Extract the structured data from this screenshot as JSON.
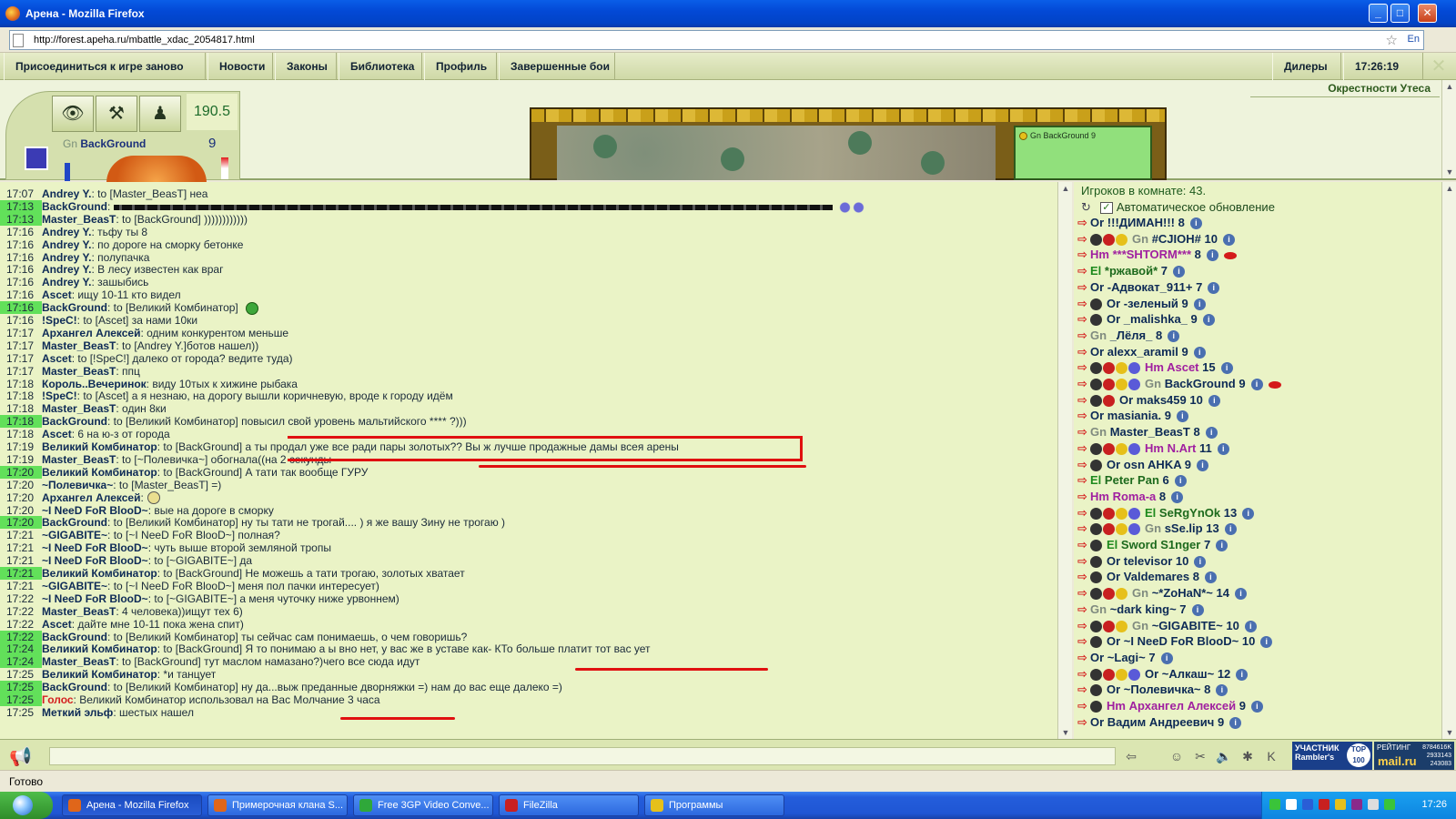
{
  "window": {
    "title": "Арена - Mozilla Firefox"
  },
  "browser": {
    "url": "http://forest.apeha.ru/mbattle_xdac_2054817.html",
    "lang": "En"
  },
  "nav": {
    "rejoin": "Присоединиться к игре заново",
    "news": "Новости",
    "laws": "Законы",
    "library": "Библиотека",
    "profile": "Профиль",
    "finished": "Завершенные бои",
    "dealers": "Дилеры",
    "time": "17:26:19"
  },
  "location": "Окрестности Утеса",
  "character": {
    "race": "Gn",
    "name": "BackGround",
    "level": "9",
    "score": "190.5"
  },
  "map": {
    "info": "Gn BackGround 9"
  },
  "chat": [
    {
      "time": "17:07",
      "hl": false,
      "who": "Andrey Y.",
      "text": ": to [Master_BeasT] неа"
    },
    {
      "time": "17:13",
      "hl": true,
      "who": "BackGround",
      "text": ":",
      "extra": "scribble"
    },
    {
      "time": "17:13",
      "hl": true,
      "who": "Master_BeasT",
      "text": ": to [BackGround] ))))))))))))"
    },
    {
      "time": "17:16",
      "hl": false,
      "who": "Andrey Y.",
      "text": ": тьфу ты 8"
    },
    {
      "time": "17:16",
      "hl": false,
      "who": "Andrey Y.",
      "text": ": по дороге на сморку бетонке"
    },
    {
      "time": "17:16",
      "hl": false,
      "who": "Andrey Y.",
      "text": ": полупачка"
    },
    {
      "time": "17:16",
      "hl": false,
      "who": "Andrey Y.",
      "text": ": В лесу известен как враг"
    },
    {
      "time": "17:16",
      "hl": false,
      "who": "Andrey Y.",
      "text": ": зашыбись"
    },
    {
      "time": "17:16",
      "hl": false,
      "who": "Ascet",
      "text": ": ищу 10-11 кто видел"
    },
    {
      "time": "17:16",
      "hl": true,
      "who": "BackGround",
      "text": ": to [Великий Комбинатор]",
      "extra": "smile"
    },
    {
      "time": "17:16",
      "hl": false,
      "who": "!SpeC!",
      "text": ": to [Ascet] за нами 10ки"
    },
    {
      "time": "17:17",
      "hl": false,
      "who": "Архангел Алексей",
      "text": ": одним конкурентом меньше"
    },
    {
      "time": "17:17",
      "hl": false,
      "who": "Master_BeasT",
      "text": ": to [Andrey Y.]ботов нашел))"
    },
    {
      "time": "17:17",
      "hl": false,
      "who": "Ascet",
      "text": ": to [!SpeC!] далеко от города? ведите туда)"
    },
    {
      "time": "17:17",
      "hl": false,
      "who": "Master_BeasT",
      "text": ": ппц"
    },
    {
      "time": "17:18",
      "hl": false,
      "who": "Король..Вечеринок",
      "text": ": виду 10тых к хижине рыбака"
    },
    {
      "time": "17:18",
      "hl": false,
      "who": "!SpeC!",
      "text": ": to [Ascet] а я незнаю, на дорогу вышли коричневую, вроде к городу идём"
    },
    {
      "time": "17:18",
      "hl": false,
      "who": "Master_BeasT",
      "text": ": один 8ки"
    },
    {
      "time": "17:18",
      "hl": true,
      "who": "BackGround",
      "text": ": to [Великий Комбинатор] повысил свой уровень мальтийского **** ?)))"
    },
    {
      "time": "17:18",
      "hl": false,
      "who": "Ascet",
      "text": ": 6 на ю-з от города"
    },
    {
      "time": "17:19",
      "hl": false,
      "who": "Великий Комбинатор",
      "text": ": to [BackGround] а ты продал уже все ради пары золотых?? Вы ж лучше продажные дамы всея арены"
    },
    {
      "time": "17:19",
      "hl": false,
      "who": "Master_BeasT",
      "text": ": to [~Полевичка~] обогнала((на 2 секунды"
    },
    {
      "time": "17:20",
      "hl": true,
      "who": "Великий Комбинатор",
      "text": ": to [BackGround] А тати так вообще ГУРУ"
    },
    {
      "time": "17:20",
      "hl": false,
      "who": "~Полевичка~",
      "text": ": to [Master_BeasT] =)"
    },
    {
      "time": "17:20",
      "hl": false,
      "who": "Архангел Алексей",
      "text": ":",
      "extra": "smile2"
    },
    {
      "time": "17:20",
      "hl": false,
      "who": "~I NeeD FoR BlooD~",
      "text": ": вые на дороге в сморку"
    },
    {
      "time": "17:20",
      "hl": true,
      "who": "BackGround",
      "text": ": to [Великий Комбинатор] ну ты тати не трогай.... ) я же вашу Зину не трогаю )"
    },
    {
      "time": "17:21",
      "hl": false,
      "who": "~GIGABITE~",
      "text": ": to [~I NeeD FoR BlooD~] полная?"
    },
    {
      "time": "17:21",
      "hl": false,
      "who": "~I NeeD FoR BlooD~",
      "text": ": чуть выше второй земляной тропы"
    },
    {
      "time": "17:21",
      "hl": false,
      "who": "~I NeeD FoR BlooD~",
      "text": ": to [~GIGABITE~] да"
    },
    {
      "time": "17:21",
      "hl": true,
      "who": "Великий Комбинатор",
      "text": ": to [BackGround] Не можешь а тати трогаю, золотых хватает"
    },
    {
      "time": "17:21",
      "hl": false,
      "who": "~GIGABITE~",
      "text": ": to [~I NeeD FoR BlooD~] меня пол пачки интересует)"
    },
    {
      "time": "17:22",
      "hl": false,
      "who": "~I NeeD FoR BlooD~",
      "text": ": to [~GIGABITE~] а меня чуточку ниже урвоннем)"
    },
    {
      "time": "17:22",
      "hl": false,
      "who": "Master_BeasT",
      "text": ": 4 человека))ищут тех 6)"
    },
    {
      "time": "17:22",
      "hl": false,
      "who": "Ascet",
      "text": ": дайте мне 10-11 пока жена спит)"
    },
    {
      "time": "17:22",
      "hl": true,
      "who": "BackGround",
      "text": ": to [Великий Комбинатор] ты сейчас сам понимаешь, о чем говоришь?"
    },
    {
      "time": "17:24",
      "hl": true,
      "who": "Великий Комбинатор",
      "text": ": to [BackGround] Я то понимаю а ы вно нет, у вас же в уставе как- КТо больше платит тот вас ует"
    },
    {
      "time": "17:24",
      "hl": true,
      "who": "Master_BeasT",
      "text": ": to [BackGround] тут маслом намазано?)чего все сюда идут"
    },
    {
      "time": "17:25",
      "hl": false,
      "who": "Великий Комбинатор",
      "text": ": *и танцует"
    },
    {
      "time": "17:25",
      "hl": true,
      "who": "BackGround",
      "text": ": to [Великий Комбинатор] ну да...выж преданные дворняжки =) нам до вас еще далеко =)"
    },
    {
      "time": "17:25",
      "hl": true,
      "who": "Голос",
      "text": ": Великий Комбинатор использовал на Вас Молчание 3 часа",
      "red": true
    },
    {
      "time": "17:25",
      "hl": false,
      "who": "Меткий эльф",
      "text": ": шестых нашел"
    }
  ],
  "players_panel": {
    "count_label": "Игроков в комнате: 43.",
    "auto_refresh": "Автоматическое обновление",
    "players": [
      {
        "race": "Or",
        "name": "!!!ДИМАН!!!",
        "level": "8",
        "icons": 0
      },
      {
        "race": "Gn",
        "name": "#CJIOH#",
        "level": "10",
        "icons": 3
      },
      {
        "race": "Hm",
        "name": "***SHTORM***",
        "level": "8",
        "icons": 0,
        "lips": true
      },
      {
        "race": "El",
        "name": "*ржавой*",
        "level": "7",
        "icons": 0
      },
      {
        "race": "Or",
        "name": "-Адвокат_911+",
        "level": "7",
        "icons": 0
      },
      {
        "race": "Or",
        "name": "-зеленый",
        "level": "9",
        "icons": 1
      },
      {
        "race": "Or",
        "name": "_malishka_",
        "level": "9",
        "icons": 1
      },
      {
        "race": "Gn",
        "name": "_Лёля_",
        "level": "8",
        "icons": 0
      },
      {
        "race": "Or",
        "name": "alexx_aramil",
        "level": "9",
        "icons": 0
      },
      {
        "race": "Hm",
        "name": "Ascet",
        "level": "15",
        "icons": 4
      },
      {
        "race": "Gn",
        "name": "BackGround",
        "level": "9",
        "icons": 4,
        "lips": true
      },
      {
        "race": "Or",
        "name": "maks459",
        "level": "10",
        "icons": 2
      },
      {
        "race": "Or",
        "name": "masiania.",
        "level": "9",
        "icons": 0
      },
      {
        "race": "Gn",
        "name": "Master_BeasT",
        "level": "8",
        "icons": 0
      },
      {
        "race": "Hm",
        "name": "N.Art",
        "level": "11",
        "icons": 4
      },
      {
        "race": "Or",
        "name": "osn AHKA",
        "level": "9",
        "icons": 1
      },
      {
        "race": "El",
        "name": "Peter Pan",
        "level": "6",
        "icons": 0
      },
      {
        "race": "Hm",
        "name": "Roma-a",
        "level": "8",
        "icons": 0
      },
      {
        "race": "El",
        "name": "SeRgYnOk",
        "level": "13",
        "icons": 4
      },
      {
        "race": "Gn",
        "name": "sSe.lip",
        "level": "13",
        "icons": 4
      },
      {
        "race": "El",
        "name": "Sword S1nger",
        "level": "7",
        "icons": 1
      },
      {
        "race": "Or",
        "name": "televisor",
        "level": "10",
        "icons": 1
      },
      {
        "race": "Or",
        "name": "Valdemares",
        "level": "8",
        "icons": 1
      },
      {
        "race": "Gn",
        "name": "~*ZoHaN*~",
        "level": "14",
        "icons": 3
      },
      {
        "race": "Gn",
        "name": "~dark king~",
        "level": "7",
        "icons": 0
      },
      {
        "race": "Gn",
        "name": "~GIGABITE~",
        "level": "10",
        "icons": 3
      },
      {
        "race": "Or",
        "name": "~I NeeD FoR BlooD~",
        "level": "10",
        "icons": 1
      },
      {
        "race": "Or",
        "name": "~Lagi~",
        "level": "7",
        "icons": 0
      },
      {
        "race": "Or",
        "name": "~Алкаш~",
        "level": "12",
        "icons": 4
      },
      {
        "race": "Or",
        "name": "~Полевичка~",
        "level": "8",
        "icons": 1
      },
      {
        "race": "Hm",
        "name": "Архангел Алексей",
        "level": "9",
        "icons": 1
      },
      {
        "race": "Or",
        "name": "Вадим Андреевич",
        "level": "9",
        "icons": 0
      }
    ]
  },
  "input": {
    "placeholder": ""
  },
  "counters": {
    "rambler_label": "УЧАСТНИК",
    "rambler_brand": "Rambler's",
    "top100": "TOP 100",
    "mail_label": "РЕЙТИНГ",
    "mail_brand": "mail.ru",
    "mail_nums": [
      "8784616K",
      "2933143",
      "243083"
    ]
  },
  "status": "Готово",
  "taskbar": {
    "items": [
      {
        "label": "Арена - Mozilla Firefox",
        "color": "#e0661a",
        "active": true
      },
      {
        "label": "Примерочная клана S...",
        "color": "#e0661a",
        "active": false
      },
      {
        "label": "Free 3GP Video Conve...",
        "color": "#2fa83a",
        "active": false
      },
      {
        "label": "FileZilla",
        "color": "#c82020",
        "active": false
      },
      {
        "label": "Программы",
        "color": "#e6c01a",
        "active": false
      }
    ],
    "clock": "17:26"
  }
}
